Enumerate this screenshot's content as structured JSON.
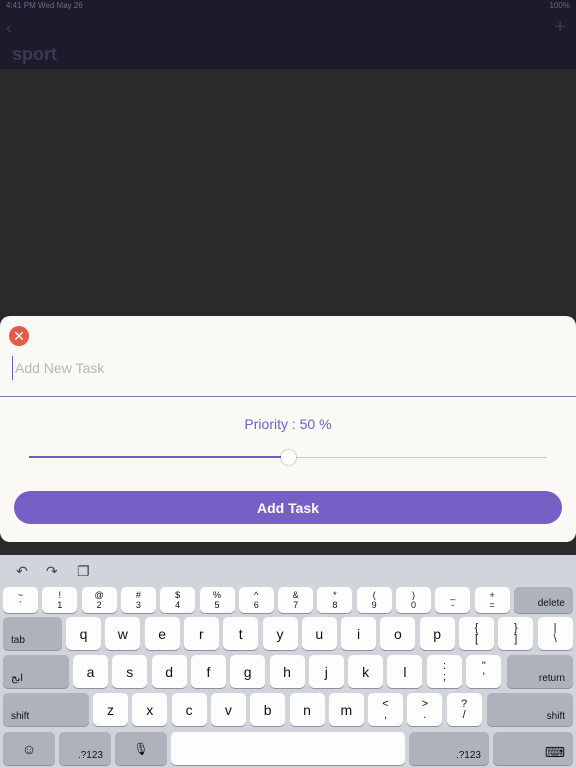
{
  "statusbar": {
    "time": "4:41 PM  Wed May 26",
    "battery": "100%"
  },
  "navbar": {
    "title": "sport",
    "back": "‹",
    "add": "+"
  },
  "sheet": {
    "close_icon": "✕",
    "input_placeholder": "Add New Task",
    "priority_label": "Priority : 50 %",
    "priority_value": 50,
    "add_button": "Add Task"
  },
  "keyboard": {
    "toolbar": {
      "undo": "↶",
      "redo": "↷",
      "paste": "❐"
    },
    "row1": [
      {
        "top": "~",
        "bottom": "`"
      },
      {
        "top": "!",
        "bottom": "1"
      },
      {
        "top": "@",
        "bottom": "2"
      },
      {
        "top": "#",
        "bottom": "3"
      },
      {
        "top": "$",
        "bottom": "4"
      },
      {
        "top": "%",
        "bottom": "5"
      },
      {
        "top": "^",
        "bottom": "6"
      },
      {
        "top": "&",
        "bottom": "7"
      },
      {
        "top": "*",
        "bottom": "8"
      },
      {
        "top": "(",
        "bottom": "9"
      },
      {
        "top": ")",
        "bottom": "0"
      },
      {
        "top": "_",
        "bottom": "-"
      },
      {
        "top": "+",
        "bottom": "="
      }
    ],
    "delete": "delete",
    "tab": "tab",
    "row2": [
      "q",
      "w",
      "e",
      "r",
      "t",
      "y",
      "u",
      "i",
      "o",
      "p"
    ],
    "row2_punct": [
      {
        "top": "{",
        "bottom": "["
      },
      {
        "top": "}",
        "bottom": "]"
      },
      {
        "top": "|",
        "bottom": "\\"
      }
    ],
    "lang": "ابج",
    "row3": [
      "a",
      "s",
      "d",
      "f",
      "g",
      "h",
      "j",
      "k",
      "l"
    ],
    "row3_punct": [
      {
        "top": ":",
        "bottom": ";"
      },
      {
        "top": "\"",
        "bottom": "'"
      }
    ],
    "return": "return",
    "shift": "shift",
    "row4": [
      "z",
      "x",
      "c",
      "v",
      "b",
      "n",
      "m"
    ],
    "row4_punct": [
      {
        "top": "<",
        "bottom": ","
      },
      {
        "top": ">",
        "bottom": "."
      },
      {
        "top": "?",
        "bottom": "/"
      }
    ],
    "emoji": "☺",
    "numbers_left": ".?123",
    "mic": "🎙",
    "numbers_right": ".?123",
    "hide_kb": "⌨"
  }
}
